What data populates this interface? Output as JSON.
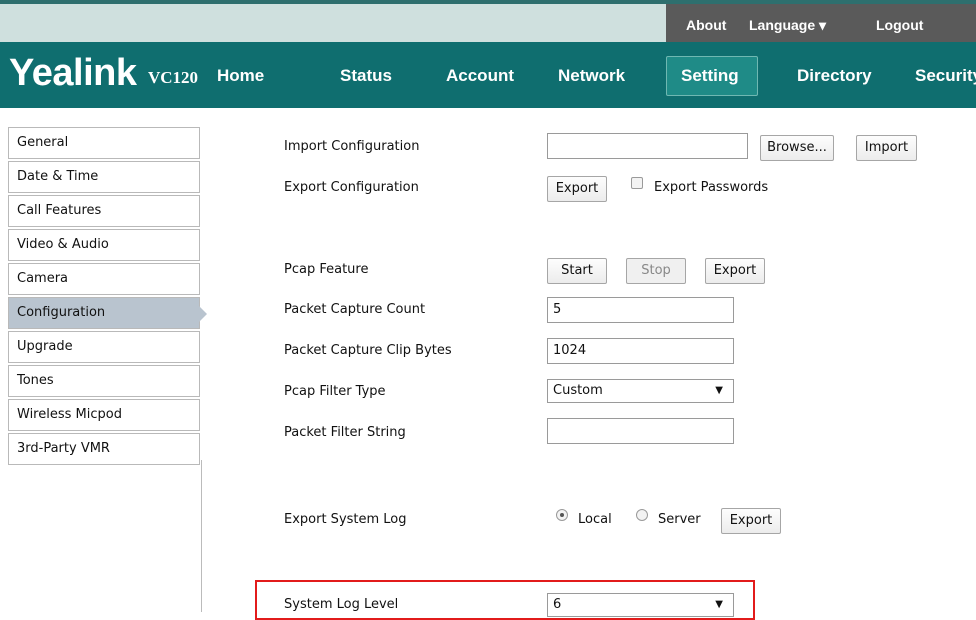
{
  "top_links": {
    "about": "About",
    "language": "Language ▾",
    "logout": "Logout"
  },
  "brand": {
    "logo": "Yealink",
    "model": "VC120"
  },
  "nav": {
    "items": [
      "Home",
      "Status",
      "Account",
      "Network",
      "Setting",
      "Directory",
      "Security"
    ],
    "active": "Setting"
  },
  "sidebar": {
    "items": [
      "General",
      "Date & Time",
      "Call Features",
      "Video & Audio",
      "Camera",
      "Configuration",
      "Upgrade",
      "Tones",
      "Wireless Micpod",
      "3rd-Party VMR"
    ],
    "active": "Configuration"
  },
  "form": {
    "import_config": {
      "label": "Import Configuration",
      "value": "",
      "browse": "Browse...",
      "import": "Import"
    },
    "export_config": {
      "label": "Export Configuration",
      "export": "Export",
      "export_passwords": "Export Passwords",
      "export_passwords_checked": false
    },
    "pcap_feature": {
      "label": "Pcap Feature",
      "start": "Start",
      "stop": "Stop",
      "export": "Export"
    },
    "packet_capture_count": {
      "label": "Packet Capture Count",
      "value": "5"
    },
    "packet_capture_clip_bytes": {
      "label": "Packet Capture Clip Bytes",
      "value": "1024"
    },
    "pcap_filter_type": {
      "label": "Pcap Filter Type",
      "value": "Custom"
    },
    "packet_filter_string": {
      "label": "Packet Filter String",
      "value": ""
    },
    "export_system_log": {
      "label": "Export System Log",
      "local": "Local",
      "server": "Server",
      "selected": "Local",
      "export": "Export"
    },
    "system_log_level": {
      "label": "System Log Level",
      "value": "6"
    }
  },
  "colors": {
    "nav_bg": "#0f6e6f",
    "nav_active": "#1f8b87",
    "top_bar": "#5a5a5a",
    "highlight": "#e21b1b",
    "sidebar_active": "#b9c4cf"
  }
}
